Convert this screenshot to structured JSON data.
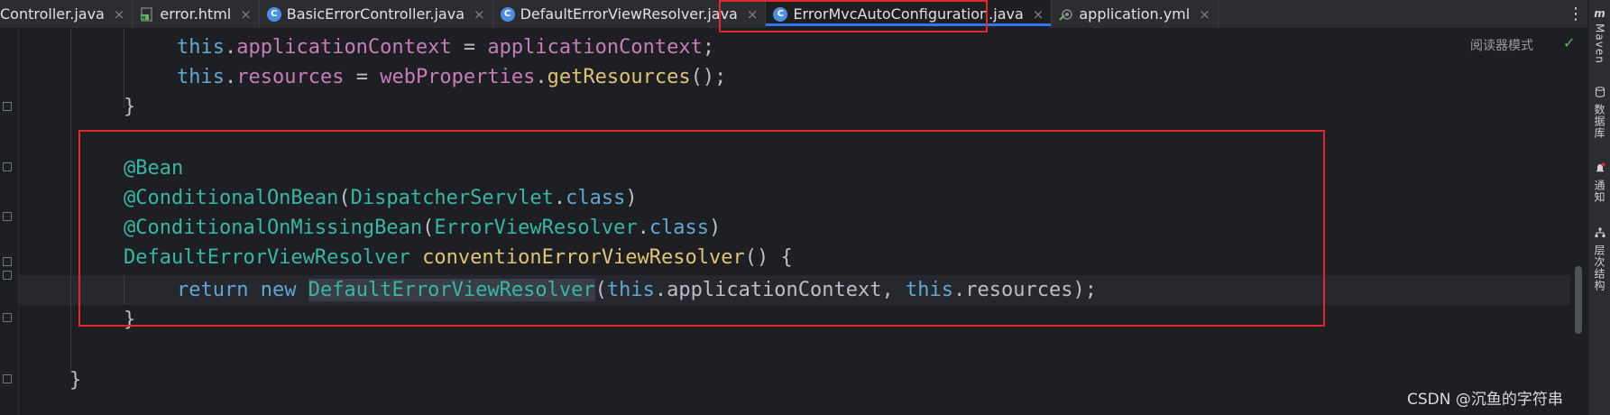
{
  "tabs": [
    {
      "label": "Controller.java",
      "icon": "java-class-icon"
    },
    {
      "label": "error.html",
      "icon": "html-file-icon"
    },
    {
      "label": "BasicErrorController.java",
      "icon": "java-class-icon"
    },
    {
      "label": "DefaultErrorViewResolver.java",
      "icon": "java-class-icon"
    },
    {
      "label": "ErrorMvcAutoConfiguration.java",
      "icon": "java-class-icon",
      "active": true
    },
    {
      "label": "application.yml",
      "icon": "yml-file-icon"
    }
  ],
  "tab_close_glyph": "×",
  "menu_glyph": "⋮",
  "reader_mode": "阅读器模式",
  "toolstrip": {
    "maven": "Maven",
    "database": "数据库",
    "notifications": "通知",
    "structure": "层次结构"
  },
  "code": {
    "l1": {
      "a": "this",
      "b": ".",
      "c": "applicationContext",
      "d": " = ",
      "e": "applicationContext",
      "f": ";"
    },
    "l2": {
      "a": "this",
      "b": ".",
      "c": "resources",
      "d": " = ",
      "e": "webProperties",
      "f": ".",
      "g": "getResources",
      "h": "();"
    },
    "l3": {
      "a": "}"
    },
    "l5": {
      "a": "@Bean"
    },
    "l6": {
      "a": "@ConditionalOnBean",
      "b": "(",
      "c": "DispatcherServlet",
      "d": ".",
      "e": "class",
      "f": ")"
    },
    "l7": {
      "a": "@ConditionalOnMissingBean",
      "b": "(",
      "c": "ErrorViewResolver",
      "d": ".",
      "e": "class",
      "f": ")"
    },
    "l8": {
      "a": "DefaultErrorViewResolver",
      "b": " ",
      "c": "conventionErrorViewResolver",
      "d": "() {"
    },
    "l9": {
      "a": "return",
      "b": " ",
      "c": "new",
      "d": " ",
      "e": "DefaultErrorViewResolver",
      "f": "(",
      "g": "this",
      "h": ".applicationContext, ",
      "i": "this",
      "j": ".resources);"
    },
    "l10": {
      "a": "}"
    },
    "l12": {
      "a": "}"
    }
  },
  "watermark": "CSDN @沉鱼的字符串",
  "colors": {
    "highlight_border": "#e5262b",
    "accent": "#3574f0"
  }
}
